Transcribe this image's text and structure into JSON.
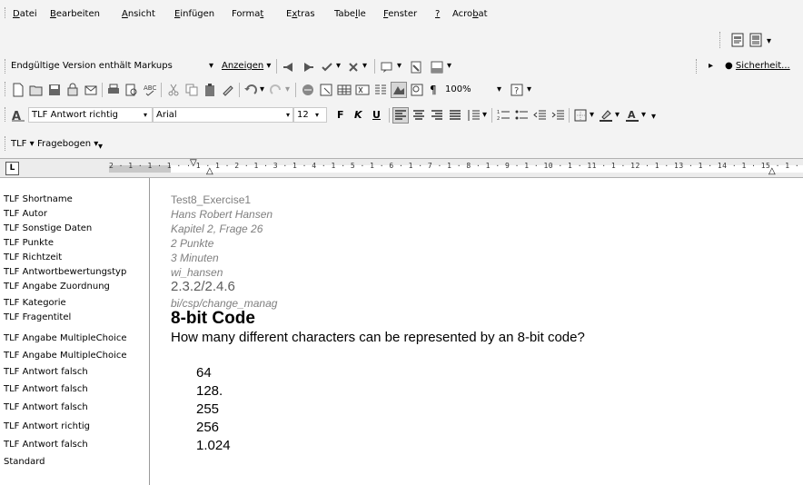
{
  "menubar": {
    "items": [
      {
        "pre": "",
        "ul": "D",
        "post": "atei"
      },
      {
        "pre": "",
        "ul": "B",
        "post": "earbeiten"
      },
      {
        "pre": "",
        "ul": "A",
        "post": "nsicht"
      },
      {
        "pre": "",
        "ul": "E",
        "post": "infügen"
      },
      {
        "pre": "Forma",
        "ul": "t",
        "post": ""
      },
      {
        "pre": "E",
        "ul": "x",
        "post": "tras"
      },
      {
        "pre": "Tabe",
        "ul": "l",
        "post": "le"
      },
      {
        "pre": "",
        "ul": "F",
        "post": "enster"
      },
      {
        "pre": "",
        "ul": "?",
        "post": ""
      },
      {
        "pre": "Acro",
        "ul": "b",
        "post": "at"
      }
    ]
  },
  "reviewing": {
    "markup_mode": "Endgültige Version enthält Markups",
    "show_label": "Anzeigen",
    "security_label": "Sicherheit..."
  },
  "standard": {
    "zoom": "100%"
  },
  "formatting": {
    "style": "TLF Antwort richtig",
    "font": "Arial",
    "size": "12",
    "bold": "F",
    "italic": "K",
    "underline": "U"
  },
  "tlf_toolbar": {
    "tlf_menu": "TLF",
    "fragebogen_menu": "Fragebogen"
  },
  "ruler": {
    "scale": "2 · 1 · 1 · 1 ·   · 1 · 1 · 2 · 1 · 3 · 1 · 4 · 1 · 5 · 1 · 6 · 1 · 7 · 1 · 8 · 1 · 9 · 1 · 10 · 1 · 11 · 1 · 12 · 1 · 13 · 1 · 14 · 1 · 15 · 1 ·"
  },
  "styles_column": [
    "TLF Shortname",
    "TLF Autor",
    "TLF Sonstige Daten",
    "TLF Punkte",
    "TLF Richtzeit",
    "TLF Antwortbewertungstyp",
    "TLF Angabe Zuordnung",
    "TLF Kategorie",
    "TLF Fragentitel",
    "TLF Angabe MultipleChoice",
    "TLF Angabe MultipleChoice",
    "TLF Antwort falsch",
    "TLF Antwort falsch",
    "TLF Antwort falsch",
    "TLF Antwort richtig",
    "TLF Antwort falsch",
    "Standard"
  ],
  "document": {
    "shortname": "Test8_Exercise1",
    "author": "Hans Robert Hansen",
    "other_data": "Kapitel 2, Frage 26",
    "points": "2 Punkte",
    "time": "3 Minuten",
    "eval_type": "wi_hansen",
    "assignment": "2.3.2/2.4.6",
    "category": "bi/csp/change_manag",
    "question_title": "8-bit Code",
    "question_text": "How many different characters can be represented by an 8-bit code?",
    "answers": [
      "64",
      "128.",
      "255",
      "256",
      "1.024"
    ]
  }
}
